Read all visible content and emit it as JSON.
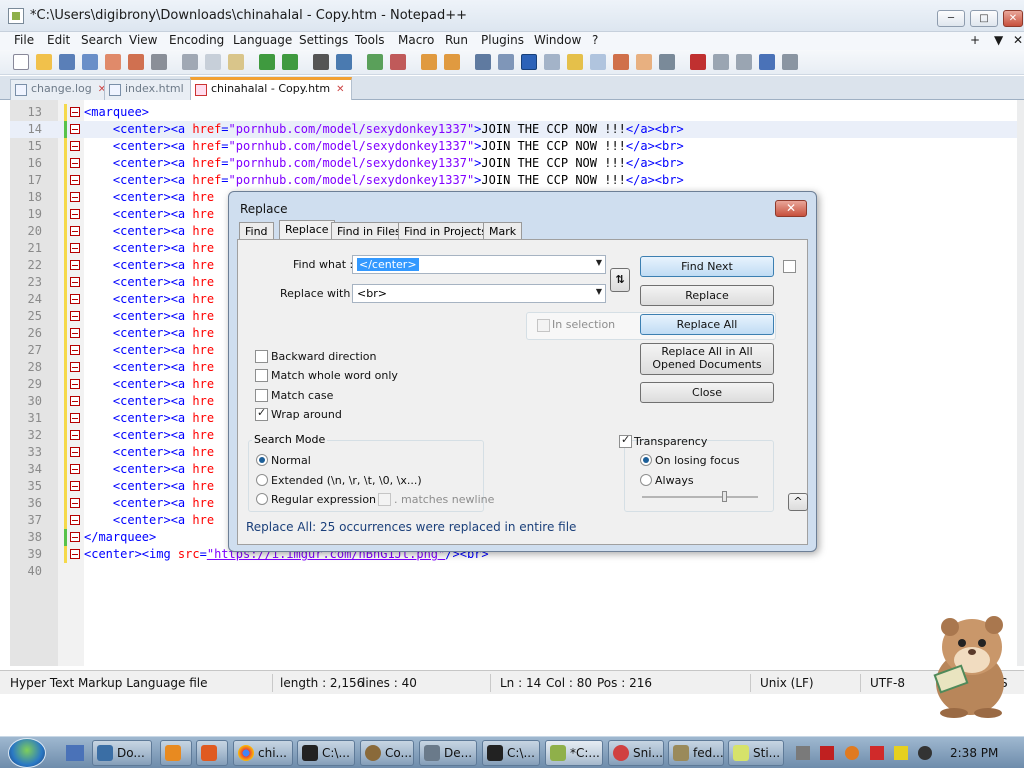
{
  "window": {
    "title": "*C:\\Users\\digibrony\\Downloads\\chinahalal - Copy.htm - Notepad++",
    "buttons": {
      "minimize": "─",
      "maximize": "□",
      "close": "✕"
    }
  },
  "menu": [
    "File",
    "Edit",
    "Search",
    "View",
    "Encoding",
    "Language",
    "Settings",
    "Tools",
    "Macro",
    "Run",
    "Plugins",
    "Window",
    "?"
  ],
  "menu_right": {
    "plus": "+",
    "down": "▼",
    "close": "✕"
  },
  "tabs": [
    {
      "label": "change.log",
      "close": "✕",
      "active": false
    },
    {
      "label": "index.html",
      "close": "✕",
      "active": false
    },
    {
      "label": "chinahalal - Copy.htm",
      "close": "✕",
      "active": true
    }
  ],
  "editor": {
    "lines": [
      {
        "n": "13",
        "parts": [
          [
            "tag",
            "<marquee>"
          ]
        ]
      },
      {
        "n": "14",
        "current": true,
        "parts": [
          [
            "txt",
            "    "
          ],
          [
            "tag",
            "<center><a "
          ],
          [
            "attr",
            "href"
          ],
          [
            "tag",
            "="
          ],
          [
            "str",
            "\"pornhub.com/model/sexydonkey1337\""
          ],
          [
            "tag",
            ">"
          ],
          [
            "txt",
            "JOIN THE CCP NOW !!!"
          ],
          [
            "tag",
            "</a><br>"
          ]
        ]
      },
      {
        "n": "15",
        "parts": [
          [
            "txt",
            "    "
          ],
          [
            "tag",
            "<center><a "
          ],
          [
            "attr",
            "href"
          ],
          [
            "tag",
            "="
          ],
          [
            "str",
            "\"pornhub.com/model/sexydonkey1337\""
          ],
          [
            "tag",
            ">"
          ],
          [
            "txt",
            "JOIN THE CCP NOW !!!"
          ],
          [
            "tag",
            "</a><br>"
          ]
        ]
      },
      {
        "n": "16",
        "parts": [
          [
            "txt",
            "    "
          ],
          [
            "tag",
            "<center><a "
          ],
          [
            "attr",
            "href"
          ],
          [
            "tag",
            "="
          ],
          [
            "str",
            "\"pornhub.com/model/sexydonkey1337\""
          ],
          [
            "tag",
            ">"
          ],
          [
            "txt",
            "JOIN THE CCP NOW !!!"
          ],
          [
            "tag",
            "</a><br>"
          ]
        ]
      },
      {
        "n": "17",
        "parts": [
          [
            "txt",
            "    "
          ],
          [
            "tag",
            "<center><a "
          ],
          [
            "attr",
            "href"
          ],
          [
            "tag",
            "="
          ],
          [
            "str",
            "\"pornhub.com/model/sexydonkey1337\""
          ],
          [
            "tag",
            ">"
          ],
          [
            "txt",
            "JOIN THE CCP NOW !!!"
          ],
          [
            "tag",
            "</a><br>"
          ]
        ]
      },
      {
        "n": "18",
        "parts": [
          [
            "txt",
            "    "
          ],
          [
            "tag",
            "<center><a "
          ],
          [
            "attr",
            "hre"
          ]
        ]
      },
      {
        "n": "19",
        "parts": [
          [
            "txt",
            "    "
          ],
          [
            "tag",
            "<center><a "
          ],
          [
            "attr",
            "hre"
          ]
        ]
      },
      {
        "n": "20",
        "parts": [
          [
            "txt",
            "    "
          ],
          [
            "tag",
            "<center><a "
          ],
          [
            "attr",
            "hre"
          ]
        ]
      },
      {
        "n": "21",
        "parts": [
          [
            "txt",
            "    "
          ],
          [
            "tag",
            "<center><a "
          ],
          [
            "attr",
            "hre"
          ]
        ]
      },
      {
        "n": "22",
        "parts": [
          [
            "txt",
            "    "
          ],
          [
            "tag",
            "<center><a "
          ],
          [
            "attr",
            "hre"
          ]
        ]
      },
      {
        "n": "23",
        "parts": [
          [
            "txt",
            "    "
          ],
          [
            "tag",
            "<center><a "
          ],
          [
            "attr",
            "hre"
          ]
        ]
      },
      {
        "n": "24",
        "parts": [
          [
            "txt",
            "    "
          ],
          [
            "tag",
            "<center><a "
          ],
          [
            "attr",
            "hre"
          ]
        ]
      },
      {
        "n": "25",
        "parts": [
          [
            "txt",
            "    "
          ],
          [
            "tag",
            "<center><a "
          ],
          [
            "attr",
            "hre"
          ]
        ]
      },
      {
        "n": "26",
        "parts": [
          [
            "txt",
            "    "
          ],
          [
            "tag",
            "<center><a "
          ],
          [
            "attr",
            "hre"
          ]
        ]
      },
      {
        "n": "27",
        "parts": [
          [
            "txt",
            "    "
          ],
          [
            "tag",
            "<center><a "
          ],
          [
            "attr",
            "hre"
          ]
        ]
      },
      {
        "n": "28",
        "parts": [
          [
            "txt",
            "    "
          ],
          [
            "tag",
            "<center><a "
          ],
          [
            "attr",
            "hre"
          ]
        ]
      },
      {
        "n": "29",
        "parts": [
          [
            "txt",
            "    "
          ],
          [
            "tag",
            "<center><a "
          ],
          [
            "attr",
            "hre"
          ]
        ]
      },
      {
        "n": "30",
        "parts": [
          [
            "txt",
            "    "
          ],
          [
            "tag",
            "<center><a "
          ],
          [
            "attr",
            "hre"
          ]
        ]
      },
      {
        "n": "31",
        "parts": [
          [
            "txt",
            "    "
          ],
          [
            "tag",
            "<center><a "
          ],
          [
            "attr",
            "hre"
          ]
        ]
      },
      {
        "n": "32",
        "parts": [
          [
            "txt",
            "    "
          ],
          [
            "tag",
            "<center><a "
          ],
          [
            "attr",
            "hre"
          ]
        ]
      },
      {
        "n": "33",
        "parts": [
          [
            "txt",
            "    "
          ],
          [
            "tag",
            "<center><a "
          ],
          [
            "attr",
            "hre"
          ]
        ]
      },
      {
        "n": "34",
        "parts": [
          [
            "txt",
            "    "
          ],
          [
            "tag",
            "<center><a "
          ],
          [
            "attr",
            "hre"
          ]
        ]
      },
      {
        "n": "35",
        "parts": [
          [
            "txt",
            "    "
          ],
          [
            "tag",
            "<center><a "
          ],
          [
            "attr",
            "hre"
          ]
        ]
      },
      {
        "n": "36",
        "parts": [
          [
            "txt",
            "    "
          ],
          [
            "tag",
            "<center><a "
          ],
          [
            "attr",
            "hre"
          ]
        ]
      },
      {
        "n": "37",
        "parts": [
          [
            "txt",
            "    "
          ],
          [
            "tag",
            "<center><a "
          ],
          [
            "attr",
            "hre"
          ]
        ]
      },
      {
        "n": "38",
        "parts": [
          [
            "tag",
            "</marquee>"
          ]
        ]
      },
      {
        "n": "39",
        "parts": [
          [
            "tag",
            "<center><img "
          ],
          [
            "attr",
            "src"
          ],
          [
            "tag",
            "="
          ],
          [
            "str",
            "\"https://i.imgur.com/hBhG1Jt.png\""
          ],
          [
            "tag",
            "/><br>"
          ]
        ]
      },
      {
        "n": "40",
        "parts": []
      }
    ]
  },
  "status": {
    "filetype": "Hyper Text Markup Language file",
    "length": "length : 2,156",
    "lines": "lines : 40",
    "ln": "Ln : 14",
    "col": "Col : 80",
    "pos": "Pos : 216",
    "eol": "Unix (LF)",
    "encoding": "UTF-8",
    "ins": "S"
  },
  "dialog": {
    "title": "Replace",
    "close": "✕",
    "tabs": [
      "Find",
      "Replace",
      "Find in Files",
      "Find in Projects",
      "Mark"
    ],
    "active_tab": "Replace",
    "find_label": "Find what :",
    "find_value": "</center>",
    "replace_label": "Replace with :",
    "replace_value": "<br>",
    "swap": "⇅",
    "in_selection": "In selection",
    "buttons": {
      "find_next": "Find Next",
      "replace": "Replace",
      "replace_all": "Replace All",
      "replace_all_opened": "Replace All in All Opened Documents",
      "close": "Close"
    },
    "options": {
      "backward": "Backward direction",
      "whole_word": "Match whole word only",
      "match_case": "Match case",
      "wrap_around": "Wrap around"
    },
    "search_mode": {
      "title": "Search Mode",
      "normal": "Normal",
      "extended": "Extended (\\n, \\r, \\t, \\0, \\x...)",
      "regex": "Regular expression",
      "matches_newline": ". matches newline"
    },
    "transparency": {
      "title": "Transparency",
      "on_losing_focus": "On losing focus",
      "always": "Always"
    },
    "collapse": "^",
    "status_message": "Replace All: 25 occurrences were replaced in entire file"
  },
  "taskbar": {
    "items": [
      "Do...",
      "",
      "",
      "chi...",
      "C:\\...",
      "Co...",
      "De...",
      "C:\\...",
      "*C:...",
      "Sni...",
      "fed...",
      "Sti..."
    ],
    "clock": "2:38 PM"
  },
  "colors": {
    "tag": "#0000ff",
    "attr": "#ff0000",
    "string": "#8000ff",
    "accent": "#f2a134"
  }
}
